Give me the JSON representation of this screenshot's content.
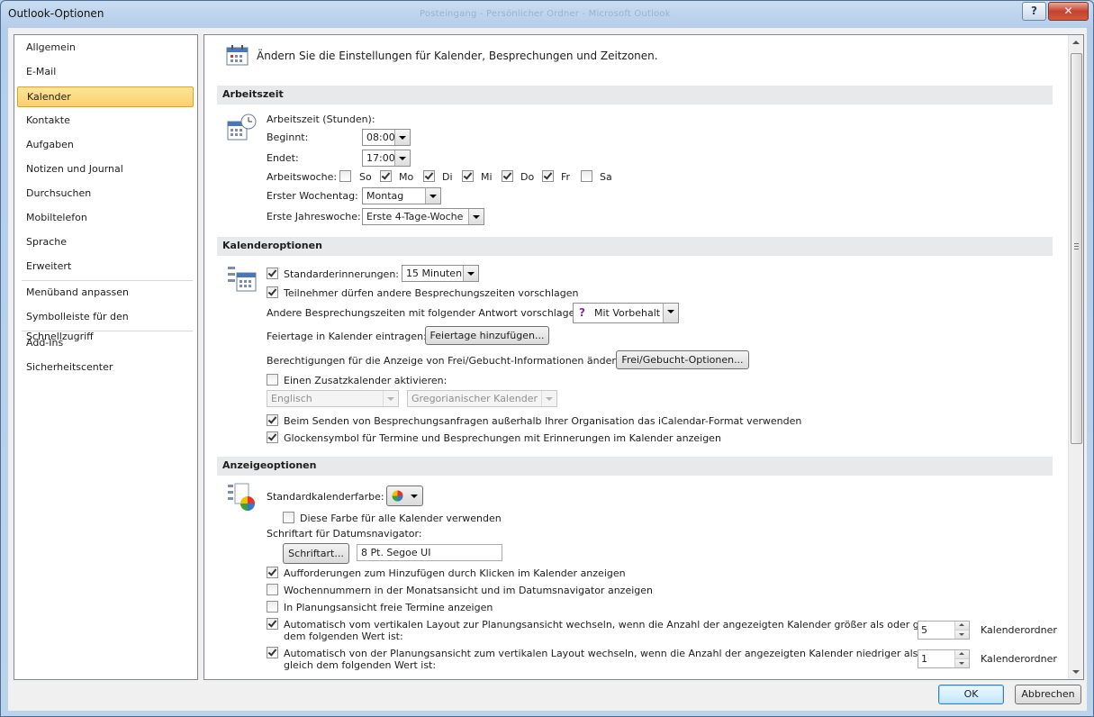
{
  "window": {
    "title": "Outlook-Optionen",
    "background_title": "Posteingang - Persönlicher Ordner - Microsoft Outlook",
    "help_icon": "?",
    "close_icon": "✕"
  },
  "nav": {
    "items": [
      {
        "label": "Allgemein"
      },
      {
        "label": "E-Mail"
      },
      {
        "label": "Kalender",
        "selected": true
      },
      {
        "label": "Kontakte"
      },
      {
        "label": "Aufgaben"
      },
      {
        "label": "Notizen und Journal"
      },
      {
        "label": "Durchsuchen"
      },
      {
        "label": "Mobiltelefon"
      },
      {
        "label": "Sprache"
      },
      {
        "label": "Erweitert"
      },
      {
        "label": "Menüband anpassen"
      },
      {
        "label": "Symbolleiste für den Schnellzugriff"
      },
      {
        "label": "Add-Ins"
      },
      {
        "label": "Sicherheitscenter"
      }
    ]
  },
  "header": {
    "text": "Ändern Sie die Einstellungen für Kalender, Besprechungen und Zeitzonen."
  },
  "arbeitszeit": {
    "section_title": "Arbeitszeit",
    "group_label": "Arbeitszeit (Stunden):",
    "beginnt_label": "Beginnt:",
    "beginnt_value": "08:00",
    "endet_label": "Endet:",
    "endet_value": "17:00",
    "arbeitswoche_label": "Arbeitswoche:",
    "days": [
      {
        "label": "So",
        "checked": false
      },
      {
        "label": "Mo",
        "checked": true
      },
      {
        "label": "Di",
        "checked": true
      },
      {
        "label": "Mi",
        "checked": true
      },
      {
        "label": "Do",
        "checked": true
      },
      {
        "label": "Fr",
        "checked": true
      },
      {
        "label": "Sa",
        "checked": false
      }
    ],
    "erster_wochentag_label": "Erster Wochentag:",
    "erster_wochentag_value": "Montag",
    "erste_jahreswoche_label": "Erste Jahreswoche:",
    "erste_jahreswoche_value": "Erste 4-Tage-Woche"
  },
  "kalenderoptionen": {
    "section_title": "Kalenderoptionen",
    "standarderinnerungen_label": "Standarderinnerungen:",
    "standarderinnerungen_value": "15 Minuten",
    "teilnehmer_label": "Teilnehmer dürfen andere Besprechungszeiten vorschlagen",
    "andere_label": "Andere Besprechungszeiten mit folgender Antwort vorschlagen:",
    "andere_value": "Mit Vorbehalt",
    "andere_icon": "?",
    "feiertage_label": "Feiertage in Kalender eintragen:",
    "feiertage_button": "Feiertage hinzufügen...",
    "berechtigungen_label": "Berechtigungen für die Anzeige von Frei/Gebucht-Informationen ändern:",
    "frei_gebucht_button": "Frei/Gebucht-Optionen...",
    "zusatzkalender_label": "Einen Zusatzkalender aktivieren:",
    "sprache_value": "Englisch",
    "kalendertyp_value": "Gregorianischer Kalender",
    "icalendar_label": "Beim Senden von Besprechungsanfragen außerhalb Ihrer Organisation das iCalendar-Format verwenden",
    "glocke_label": "Glockensymbol für Termine und Besprechungen mit Erinnerungen im Kalender anzeigen"
  },
  "anzeigeoptionen": {
    "section_title": "Anzeigeoptionen",
    "standardfarbe_label": "Standardkalenderfarbe:",
    "diese_farbe_label": "Diese Farbe für alle Kalender verwenden",
    "schriftart_label": "Schriftart für Datumsnavigator:",
    "schriftart_button": "Schriftart...",
    "schriftart_value": "8 Pt. Segoe UI",
    "aufforderungen_label": "Aufforderungen zum Hinzufügen durch Klicken im Kalender anzeigen",
    "wochennummern_label": "Wochennummern in der Monatsansicht und im Datumsnavigator anzeigen",
    "planungsansicht_label": "In Planungsansicht freie Termine anzeigen",
    "auto_vertikal_line1": "Automatisch vom vertikalen Layout zur Planungsansicht wechseln, wenn die Anzahl der angezeigten Kalender größer als oder gleich",
    "auto_vertikal_line2": "dem folgenden Wert ist:",
    "auto_vertikal_value": "5",
    "auto_planung_line1": "Automatisch von der Planungsansicht zum vertikalen Layout wechseln, wenn die Anzahl der angezeigten Kalender niedriger als oder",
    "auto_planung_line2": "gleich dem folgenden Wert ist:",
    "auto_planung_value": "1",
    "kalenderordner_label": "Kalenderordner"
  },
  "footer": {
    "ok": "OK",
    "cancel": "Abbrechen"
  },
  "colors": {
    "selected_nav": "#fbd06b",
    "section_bg": "#e8e9ea",
    "tentative_purple": "#8b2c9f"
  }
}
